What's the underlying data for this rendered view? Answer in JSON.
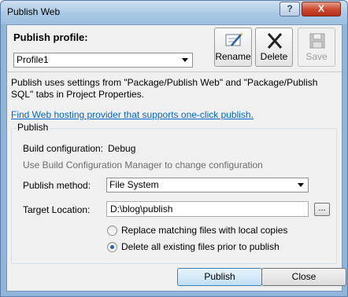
{
  "window": {
    "title": "Publish Web",
    "help_label": "?",
    "close_label": "X"
  },
  "profile": {
    "label": "Publish profile:",
    "selected": "Profile1",
    "rename_label": "Rename",
    "delete_label": "Delete",
    "save_label": "Save"
  },
  "description": "Publish uses settings from \"Package/Publish Web\" and \"Package/Publish SQL\" tabs in Project Properties.",
  "link_text": "Find Web hosting provider that supports one-click publish.",
  "publish_group": {
    "title": "Publish",
    "build_config_label": "Build configuration:",
    "build_config_value": "Debug",
    "build_config_hint": "Use Build Configuration Manager to change configuration",
    "method_label": "Publish method:",
    "method_value": "File System",
    "target_label": "Target Location:",
    "target_value": "D:\\blog\\publish",
    "browse_label": "...",
    "option_replace": "Replace matching files with local copies",
    "option_delete": "Delete all existing files prior to publish",
    "selected_option": "option_delete"
  },
  "buttons": {
    "publish": "Publish",
    "close": "Close"
  },
  "colors": {
    "link": "#0066cc",
    "close_button": "#c9452a",
    "title_bar": "#a9c8e6"
  }
}
